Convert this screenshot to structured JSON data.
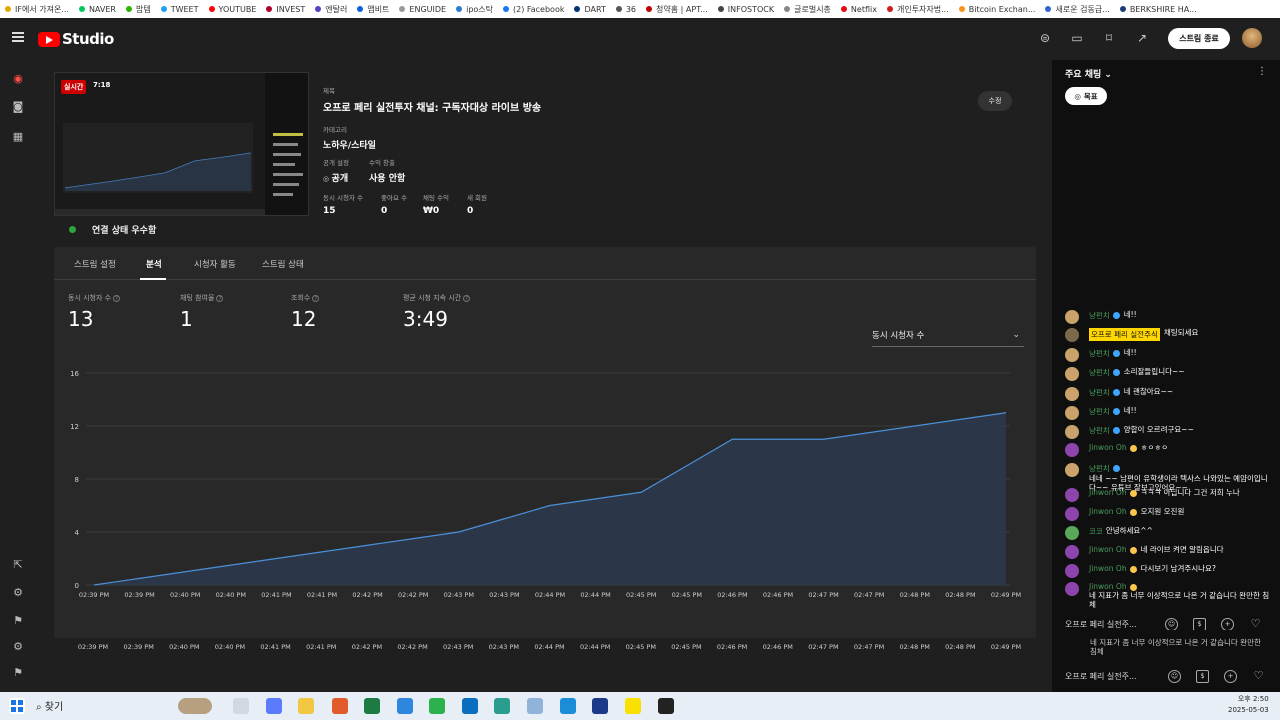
{
  "bookmarks": [
    {
      "label": "IF에서 가져온...",
      "color": "#e0a800"
    },
    {
      "label": "NAVER",
      "color": "#03c75a"
    },
    {
      "label": "밥템",
      "color": "#2db400"
    },
    {
      "label": "TWEET",
      "color": "#1da1f2"
    },
    {
      "label": "YOUTUBE",
      "color": "#ff0000"
    },
    {
      "label": "INVEST",
      "color": "#b0002a"
    },
    {
      "label": "엔탈러",
      "color": "#5a3fc0"
    },
    {
      "label": "앱비트",
      "color": "#0a5fdb"
    },
    {
      "label": "ENGUIDE",
      "color": "#999999"
    },
    {
      "label": "ipo스탁",
      "color": "#2b7bd6"
    },
    {
      "label": "(2) Facebook",
      "color": "#1877f2"
    },
    {
      "label": "DART",
      "color": "#003478"
    },
    {
      "label": "36",
      "color": "#555555"
    },
    {
      "label": "청약홈 | APT...",
      "color": "#c00000"
    },
    {
      "label": "INFOSTOCK",
      "color": "#444444"
    },
    {
      "label": "글로벌시총",
      "color": "#888888"
    },
    {
      "label": "Netflix",
      "color": "#e50914"
    },
    {
      "label": "개인투자자법...",
      "color": "#d01c1c"
    },
    {
      "label": "Bitcoin Exchan...",
      "color": "#f7931a"
    },
    {
      "label": "새로운 검동급...",
      "color": "#3366cc"
    },
    {
      "label": "BERKSHIRE HA...",
      "color": "#1a3d7a"
    }
  ],
  "header": {
    "logo_text": "Studio",
    "end_stream_label": "스트림 종료"
  },
  "stream": {
    "live_label": "실시간",
    "duration": "7:18",
    "title_label": "제목",
    "title": "오프로 페리 실전투자 채널: 구독자대상 라이브 방송",
    "category_label": "카테고리",
    "category": "노하우/스타일",
    "visibility_label": "공개 설정",
    "visibility": "공개",
    "monetization_label": "수익 창출",
    "monetization": "사용 안함",
    "stats": [
      {
        "label": "동시 시청자 수",
        "value": "15"
      },
      {
        "label": "좋아요 수",
        "value": "0"
      },
      {
        "label": "채팅 수익",
        "value": "₩0"
      },
      {
        "label": "새 회원",
        "value": "0"
      }
    ],
    "edit_label": "수정",
    "connection": "연결 상태 우수함"
  },
  "tabs": [
    "스트림 설정",
    "분석",
    "시청자 활동",
    "스트림 상태"
  ],
  "metrics": [
    {
      "label": "동시 시청자 수",
      "value": "13"
    },
    {
      "label": "채팅 참여율",
      "value": "1"
    },
    {
      "label": "조회수",
      "value": "12"
    },
    {
      "label": "평균 시청 지속 시간",
      "value": "3:49"
    }
  ],
  "dropdown": {
    "selected": "동시 시청자 수"
  },
  "chart_data": {
    "type": "area",
    "x": [
      "02:39 PM",
      "02:39 PM",
      "02:40 PM",
      "02:40 PM",
      "02:41 PM",
      "02:41 PM",
      "02:42 PM",
      "02:42 PM",
      "02:43 PM",
      "02:43 PM",
      "02:44 PM",
      "02:44 PM",
      "02:45 PM",
      "02:45 PM",
      "02:46 PM",
      "02:46 PM",
      "02:47 PM",
      "02:47 PM",
      "02:48 PM",
      "02:48 PM",
      "02:49 PM"
    ],
    "y": [
      0,
      0.5,
      1,
      1.5,
      2,
      2.5,
      3,
      3.5,
      4,
      5,
      6,
      6.5,
      7,
      9,
      11,
      11,
      11,
      11.5,
      12,
      12.5,
      13
    ],
    "yticks": [
      0,
      4,
      8,
      12,
      16
    ],
    "ylim": [
      0,
      16
    ],
    "line_color": "#4a90d9",
    "fill_color": "#2b3a4d",
    "grid": true
  },
  "chat": {
    "header": "주요 채팅",
    "goal_chip": "목표",
    "messages": [
      {
        "author": "냥펀치",
        "text": "네!!",
        "avatar": "#c9a36b",
        "badge": "blue"
      },
      {
        "author": "오프로 페리 실전주식",
        "text": "채팅되세요",
        "avatar": "#7a6a4a",
        "owner": true
      },
      {
        "author": "냥펀치",
        "text": "네!!",
        "avatar": "#c9a36b",
        "badge": "blue"
      },
      {
        "author": "냥펀치",
        "text": "소리잘들립니다~~",
        "avatar": "#c9a36b",
        "badge": "blue"
      },
      {
        "author": "냥펀치",
        "text": "네 괜찮아요~~",
        "avatar": "#c9a36b",
        "badge": "blue"
      },
      {
        "author": "냥펀치",
        "text": "네!!",
        "avatar": "#c9a36b",
        "badge": "blue"
      },
      {
        "author": "냥펀치",
        "text": "양합이 오르려구요~~",
        "avatar": "#c9a36b",
        "badge": "blue"
      },
      {
        "author": "Jinwon Oh",
        "text": "ㅎㅇㅎㅇ",
        "avatar": "#8e44ad",
        "badge": "gold"
      },
      {
        "author": "냥펀치",
        "text": "네네 ~~ 남편이 유학생이라 텍사스 나와있는 예얌이입니다~~ 유튜브 잘보고있어요~~",
        "avatar": "#c9a36b",
        "badge": "blue"
      },
      {
        "author": "Jinwon Oh",
        "text": "ㅋㅋㅋ 아닙니다 그건 저희 누나",
        "avatar": "#8e44ad",
        "badge": "gold"
      },
      {
        "author": "Jinwon Oh",
        "text": "오지원 오진원",
        "avatar": "#8e44ad",
        "badge": "gold"
      },
      {
        "author": "코코",
        "text": "안녕하세요^^",
        "avatar": "#5aa85a"
      },
      {
        "author": "Jinwon Oh",
        "text": "네 라이브 켜면 알림옵니다",
        "avatar": "#8e44ad",
        "badge": "gold"
      },
      {
        "author": "Jinwon Oh",
        "text": "다시보기 남겨주시나요?",
        "avatar": "#8e44ad",
        "badge": "gold"
      },
      {
        "author": "Jinwon Oh",
        "text": "네 지표가 좀 너무 이상적으로 나온 거 같습니다 완만한 침체",
        "avatar": "#8e44ad",
        "badge": "gold"
      }
    ],
    "input_placeholder": "오프로 페리 실전주...",
    "dup_text": "네 지표가 좀 너무 이상적으로 나온 거 같습니다 완만한 침체",
    "dup_input": "오프로 페리 실전주..."
  },
  "taskbar": {
    "search": "찾기",
    "time": "오후 2:50",
    "date": "2025-05-03"
  }
}
